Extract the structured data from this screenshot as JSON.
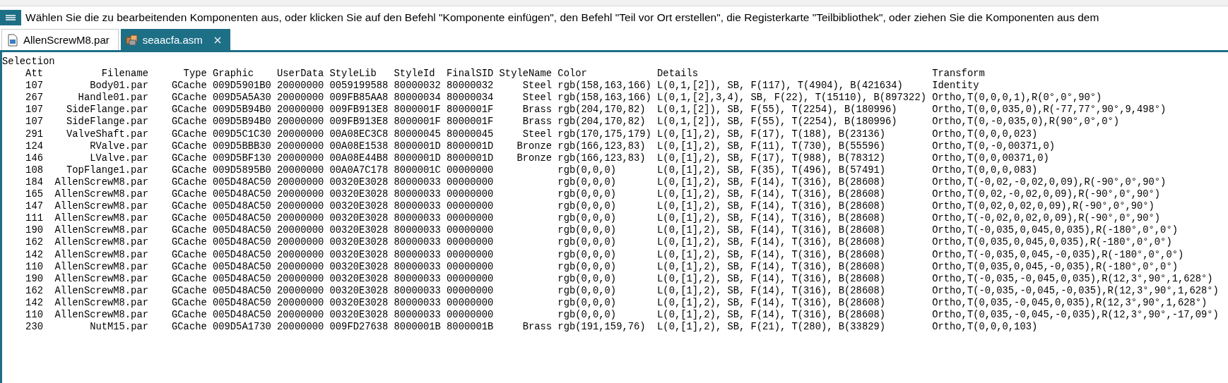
{
  "prompt": "Wählen Sie die zu bearbeitenden Komponenten aus, oder klicken Sie auf den Befehl \"Komponente einfügen\", den Befehl \"Teil vor Ort erstellen\", die Registerkarte \"Teilbibliothek\", oder ziehen Sie die Komponenten aus dem",
  "tabs": [
    {
      "label": "AllenScrewM8.par",
      "kind": "part",
      "selected": false
    },
    {
      "label": "seaacfa.asm",
      "kind": "assembly",
      "selected": true
    }
  ],
  "title": "Selection",
  "table": {
    "columns": [
      "Att",
      "Filename",
      "Type",
      "Graphic",
      "UserData",
      "StyleLib",
      "StyleId",
      "FinalSID",
      "StyleName",
      "Color",
      "Details",
      "Transform"
    ],
    "rows": [
      [
        "107",
        "Body01.par",
        "GCache",
        "009D5901B0",
        "20000000",
        "0059199588",
        "80000032",
        "80000032",
        "Steel",
        "rgb(158,163,166)",
        "L(0,1,[2]), SB, F(117), T(4904), B(421634)",
        "Identity"
      ],
      [
        "267",
        "Handle01.par",
        "GCache",
        "009D5A5A30",
        "20000000",
        "009FB85AA8",
        "80000034",
        "80000034",
        "Steel",
        "rgb(158,163,166)",
        "L(0,1,[2],3,4), SB, F(22), T(15110), B(897322)",
        "Ortho,T(0,0,0,1),R(0°,0°,90°)"
      ],
      [
        "107",
        "SideFlange.par",
        "GCache",
        "009D5B94B0",
        "20000000",
        "009FB913E8",
        "8000001F",
        "8000001F",
        "Brass",
        "rgb(204,170,82)",
        "L(0,1,[2]), SB, F(55), T(2254), B(180996)",
        "Ortho,T(0,0,035,0),R(-77,77°,90°,9,498°)"
      ],
      [
        "107",
        "SideFlange.par",
        "GCache",
        "009D5B94B0",
        "20000000",
        "009FB913E8",
        "8000001F",
        "8000001F",
        "Brass",
        "rgb(204,170,82)",
        "L(0,1,[2]), SB, F(55), T(2254), B(180996)",
        "Ortho,T(0,-0,035,0),R(90°,0°,0°)"
      ],
      [
        "291",
        "ValveShaft.par",
        "GCache",
        "009D5C1C30",
        "20000000",
        "00A08EC3C8",
        "80000045",
        "80000045",
        "Steel",
        "rgb(170,175,179)",
        "L(0,[1],2), SB, F(17), T(188), B(23136)",
        "Ortho,T(0,0,0,023)"
      ],
      [
        "124",
        "RValve.par",
        "GCache",
        "009D5BBB30",
        "20000000",
        "00A08E1538",
        "8000001D",
        "8000001D",
        "Bronze",
        "rgb(166,123,83)",
        "L(0,[1],2), SB, F(11), T(730), B(55596)",
        "Ortho,T(0,-0,00371,0)"
      ],
      [
        "146",
        "LValve.par",
        "GCache",
        "009D5BF130",
        "20000000",
        "00A08E44B8",
        "8000001D",
        "8000001D",
        "Bronze",
        "rgb(166,123,83)",
        "L(0,[1],2), SB, F(17), T(988), B(78312)",
        "Ortho,T(0,0,00371,0)"
      ],
      [
        "108",
        "TopFlange1.par",
        "GCache",
        "009D5895B0",
        "20000000",
        "00A0A7C178",
        "8000001C",
        "00000000",
        "",
        "rgb(0,0,0)",
        "L(0,[1],2), SB, F(35), T(496), B(57491)",
        "Ortho,T(0,0,0,083)"
      ],
      [
        "184",
        "AllenScrewM8.par",
        "GCache",
        "005D48AC50",
        "20000000",
        "00320E3028",
        "80000033",
        "00000000",
        "",
        "rgb(0,0,0)",
        "L(0,[1],2), SB, F(14), T(316), B(28608)",
        "Ortho,T(-0,02,-0,02,0,09),R(-90°,0°,90°)"
      ],
      [
        "165",
        "AllenScrewM8.par",
        "GCache",
        "005D48AC50",
        "20000000",
        "00320E3028",
        "80000033",
        "00000000",
        "",
        "rgb(0,0,0)",
        "L(0,[1],2), SB, F(14), T(316), B(28608)",
        "Ortho,T(0,02,-0,02,0,09),R(-90°,0°,90°)"
      ],
      [
        "147",
        "AllenScrewM8.par",
        "GCache",
        "005D48AC50",
        "20000000",
        "00320E3028",
        "80000033",
        "00000000",
        "",
        "rgb(0,0,0)",
        "L(0,[1],2), SB, F(14), T(316), B(28608)",
        "Ortho,T(0,02,0,02,0,09),R(-90°,0°,90°)"
      ],
      [
        "111",
        "AllenScrewM8.par",
        "GCache",
        "005D48AC50",
        "20000000",
        "00320E3028",
        "80000033",
        "00000000",
        "",
        "rgb(0,0,0)",
        "L(0,[1],2), SB, F(14), T(316), B(28608)",
        "Ortho,T(-0,02,0,02,0,09),R(-90°,0°,90°)"
      ],
      [
        "190",
        "AllenScrewM8.par",
        "GCache",
        "005D48AC50",
        "20000000",
        "00320E3028",
        "80000033",
        "00000000",
        "",
        "rgb(0,0,0)",
        "L(0,[1],2), SB, F(14), T(316), B(28608)",
        "Ortho,T(-0,035,0,045,0,035),R(-180°,0°,0°)"
      ],
      [
        "162",
        "AllenScrewM8.par",
        "GCache",
        "005D48AC50",
        "20000000",
        "00320E3028",
        "80000033",
        "00000000",
        "",
        "rgb(0,0,0)",
        "L(0,[1],2), SB, F(14), T(316), B(28608)",
        "Ortho,T(0,035,0,045,0,035),R(-180°,0°,0°)"
      ],
      [
        "142",
        "AllenScrewM8.par",
        "GCache",
        "005D48AC50",
        "20000000",
        "00320E3028",
        "80000033",
        "00000000",
        "",
        "rgb(0,0,0)",
        "L(0,[1],2), SB, F(14), T(316), B(28608)",
        "Ortho,T(-0,035,0,045,-0,035),R(-180°,0°,0°)"
      ],
      [
        "110",
        "AllenScrewM8.par",
        "GCache",
        "005D48AC50",
        "20000000",
        "00320E3028",
        "80000033",
        "00000000",
        "",
        "rgb(0,0,0)",
        "L(0,[1],2), SB, F(14), T(316), B(28608)",
        "Ortho,T(0,035,0,045,-0,035),R(-180°,0°,0°)"
      ],
      [
        "190",
        "AllenScrewM8.par",
        "GCache",
        "005D48AC50",
        "20000000",
        "00320E3028",
        "80000033",
        "00000000",
        "",
        "rgb(0,0,0)",
        "L(0,[1],2), SB, F(14), T(316), B(28608)",
        "Ortho,T(-0,035,-0,045,0,035),R(12,3°,90°,1,628°)"
      ],
      [
        "162",
        "AllenScrewM8.par",
        "GCache",
        "005D48AC50",
        "20000000",
        "00320E3028",
        "80000033",
        "00000000",
        "",
        "rgb(0,0,0)",
        "L(0,[1],2), SB, F(14), T(316), B(28608)",
        "Ortho,T(-0,035,-0,045,-0,035),R(12,3°,90°,1,628°)"
      ],
      [
        "142",
        "AllenScrewM8.par",
        "GCache",
        "005D48AC50",
        "20000000",
        "00320E3028",
        "80000033",
        "00000000",
        "",
        "rgb(0,0,0)",
        "L(0,[1],2), SB, F(14), T(316), B(28608)",
        "Ortho,T(0,035,-0,045,0,035),R(12,3°,90°,1,628°)"
      ],
      [
        "110",
        "AllenScrewM8.par",
        "GCache",
        "005D48AC50",
        "20000000",
        "00320E3028",
        "80000033",
        "00000000",
        "",
        "rgb(0,0,0)",
        "L(0,[1],2), SB, F(14), T(316), B(28608)",
        "Ortho,T(0,035,-0,045,-0,035),R(12,3°,90°,-17,09°)"
      ],
      [
        "230",
        "NutM15.par",
        "GCache",
        "009D5A1730",
        "20000000",
        "009FD27638",
        "8000001B",
        "8000001B",
        "Brass",
        "rgb(191,159,76)",
        "L(0,[1],2), SB, F(21), T(280), B(33829)",
        "Ortho,T(0,0,0,103)"
      ]
    ]
  }
}
